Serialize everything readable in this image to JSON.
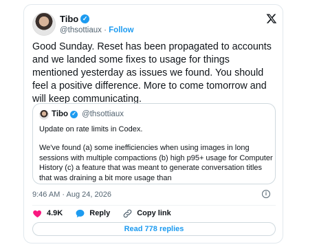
{
  "author": {
    "name": "Tibo",
    "handle": "@thsottiaux",
    "separator": "·",
    "follow_label": "Follow"
  },
  "post": {
    "text": "Good Sunday. Reset has been propagated to accounts and we landed some fixes to usage for things mentioned yesterday as issues we found. You should feel a positive difference. More to come tomorrow and will keep communicating.",
    "timestamp": "9:46 AM · Aug 24, 2026"
  },
  "quoted": {
    "name": "Tibo",
    "handle": "@thsottiaux",
    "line1": "Update on rate limits in Codex.",
    "paragraph": "We've found (a) some inefficiencies when using images in long sessions with multiple compactions (b) high p95+ usage for Computer History (c) a feature that was meant to generate conversation titles that was draining a bit more usage than"
  },
  "actions": {
    "likes": "4.9K",
    "reply_label": "Reply",
    "copy_link_label": "Copy link"
  },
  "replies_button": "Read 778 replies",
  "colors": {
    "accent": "#1d9bf0",
    "like": "#f91880",
    "text": "#0f1419",
    "muted": "#536471"
  },
  "icons": [
    "x-logo-icon",
    "verified-badge-icon",
    "heart-icon",
    "reply-icon",
    "link-icon",
    "info-icon"
  ]
}
